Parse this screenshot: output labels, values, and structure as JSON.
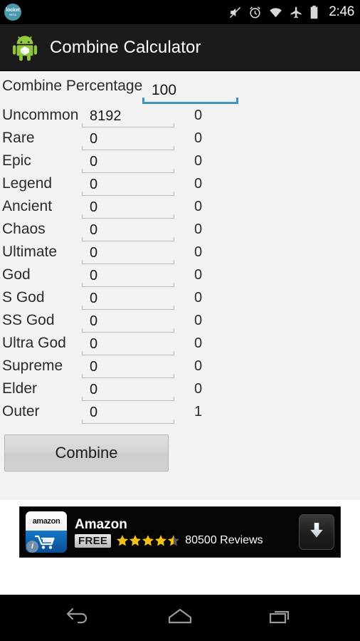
{
  "status_bar": {
    "notification_icon": "locket-icon",
    "notification_label": "locket",
    "notification_sub": "BETA",
    "icons": [
      "mute-icon",
      "alarm-icon",
      "wifi-icon",
      "airplane-mode-icon",
      "battery-icon"
    ],
    "time": "2:46"
  },
  "action_bar": {
    "app_icon": "android-robot-icon",
    "title": "Combine Calculator"
  },
  "main": {
    "percentage": {
      "label": "Combine Percentage",
      "value": "100",
      "focused": true,
      "accent_color": "#4093bd"
    },
    "columns": [
      "tier",
      "count",
      "result"
    ],
    "rows": [
      {
        "label": "Uncommon",
        "value": "8192",
        "result": "0"
      },
      {
        "label": "Rare",
        "value": "0",
        "result": "0"
      },
      {
        "label": "Epic",
        "value": "0",
        "result": "0"
      },
      {
        "label": "Legend",
        "value": "0",
        "result": "0"
      },
      {
        "label": "Ancient",
        "value": "0",
        "result": "0"
      },
      {
        "label": "Chaos",
        "value": "0",
        "result": "0"
      },
      {
        "label": "Ultimate",
        "value": "0",
        "result": "0"
      },
      {
        "label": "God",
        "value": "0",
        "result": "0"
      },
      {
        "label": "S God",
        "value": "0",
        "result": "0"
      },
      {
        "label": "SS God",
        "value": "0",
        "result": "0"
      },
      {
        "label": "Ultra God",
        "value": "0",
        "result": "0"
      },
      {
        "label": "Supreme",
        "value": "0",
        "result": "0"
      },
      {
        "label": "Elder",
        "value": "0",
        "result": "0"
      },
      {
        "label": "Outer",
        "value": "0",
        "result": "1"
      }
    ],
    "combine_button": "Combine"
  },
  "ad": {
    "icon": "amazon-app-icon",
    "icon_wordmark": "amazon",
    "info_badge": "i",
    "title": "Amazon",
    "price_badge": "FREE",
    "rating": 4.5,
    "reviews": "80500 Reviews",
    "download_icon": "download-arrow-icon",
    "star_color": "#f5c016"
  },
  "nav_bar": {
    "buttons": [
      {
        "name": "back-button",
        "icon": "back-arrow-icon"
      },
      {
        "name": "home-button",
        "icon": "home-icon"
      },
      {
        "name": "recents-button",
        "icon": "recent-apps-icon"
      }
    ]
  }
}
